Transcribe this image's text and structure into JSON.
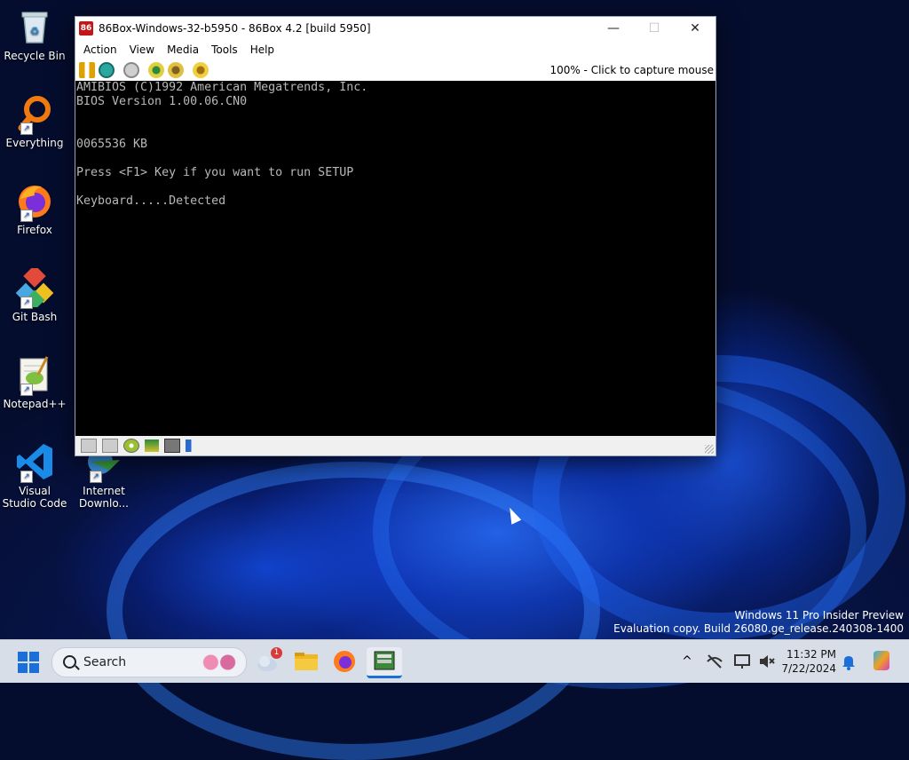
{
  "desktop": {
    "icons": [
      {
        "label": "Recycle Bin",
        "icon": "recycle-bin-icon"
      },
      {
        "label": "Everything",
        "icon": "everything-search-icon"
      },
      {
        "label": "Firefox",
        "icon": "firefox-icon"
      },
      {
        "label": "Git Bash",
        "icon": "git-bash-icon"
      },
      {
        "label": "Notepad++",
        "icon": "notepad-plus-plus-icon"
      },
      {
        "label": "Visual Studio Code",
        "icon": "vscode-icon"
      },
      {
        "label": "Internet Downlo...",
        "icon": "internet-download-manager-icon"
      }
    ]
  },
  "window": {
    "title": "86Box-Windows-32-b5950 - 86Box 4.2 [build 5950]",
    "controls": {
      "minimize": "—",
      "maximize": "☐",
      "close": "✕"
    },
    "menu": [
      "Action",
      "View",
      "Media",
      "Tools",
      "Help"
    ],
    "toolbar_status": "100% - Click to capture mouse",
    "screen_lines": [
      "AMIBIOS (C)1992 American Megatrends, Inc.",
      "BIOS Version 1.00.06.CN0",
      "0065536 KB",
      "Press <F1> Key if you want to run SETUP",
      "Keyboard.....Detected"
    ]
  },
  "watermark": {
    "line1": "Windows 11 Pro Insider Preview",
    "line2": "Evaluation copy. Build 26080.ge_release.240308-1400"
  },
  "taskbar": {
    "search_label": "Search",
    "weather_badge": "1",
    "clock_time": "11:32 PM",
    "clock_date": "7/22/2024"
  },
  "colors": {
    "accent": "#1a6fd8",
    "screen_bg": "#000000",
    "screen_text": "#b8b8b8"
  }
}
